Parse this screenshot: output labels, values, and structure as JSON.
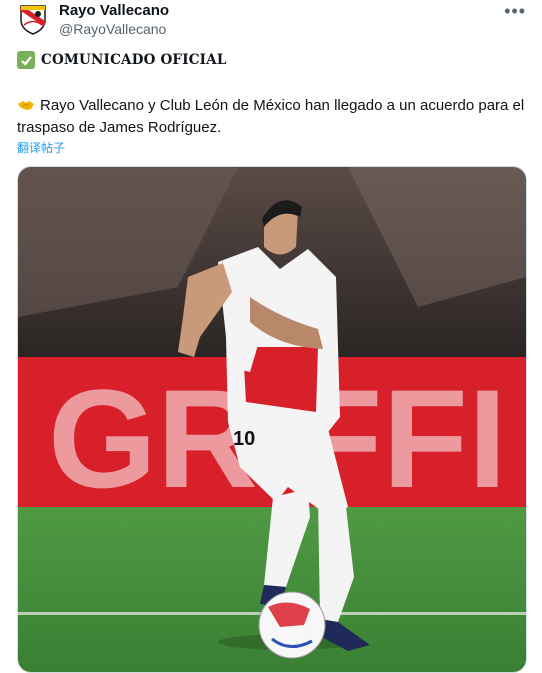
{
  "account": {
    "name": "Rayo Vallecano",
    "handle": "@RayoVallecano"
  },
  "post": {
    "heading": "COMUNICADO OFICIAL",
    "text": "Rayo Vallecano y Club León de México han llegado a un acuerdo para el traspaso de James Rodríguez.",
    "translate_label": "翻译帖子"
  },
  "icons": {
    "more": "more-options-icon",
    "check": "check-mark-icon",
    "handshake": "handshake-icon"
  },
  "photo": {
    "board_text": "GRIFFI",
    "shirt_number": "10"
  },
  "colors": {
    "brand_red": "#d8202a",
    "link_blue": "#1d9bf0",
    "grass": "#3f8a3a"
  }
}
